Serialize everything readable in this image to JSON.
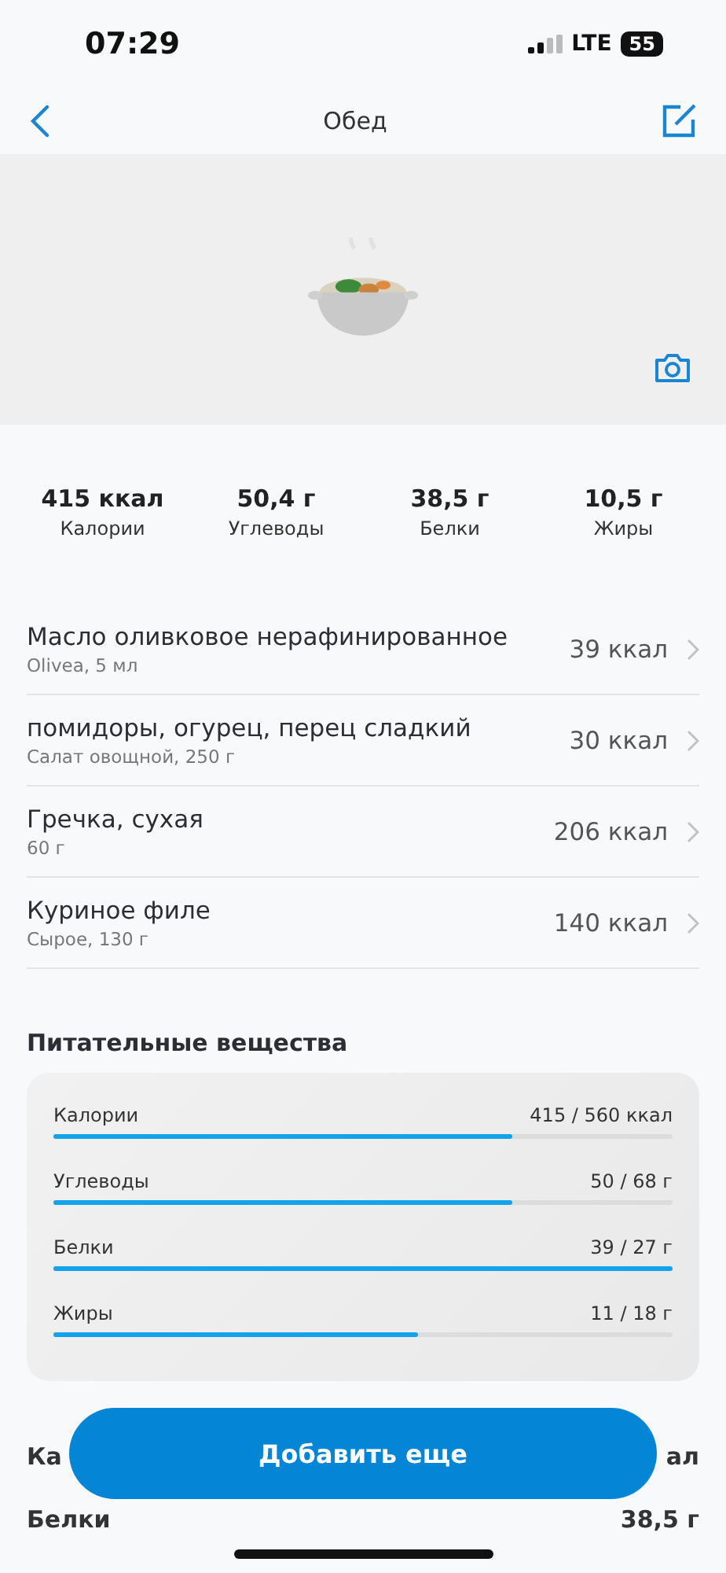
{
  "status_bar": {
    "time": "07:29",
    "network": "LTE",
    "battery": "55"
  },
  "nav": {
    "title": "Обед"
  },
  "totals": [
    {
      "value": "415 ккал",
      "label": "Калории"
    },
    {
      "value": "50,4 г",
      "label": "Углеводы"
    },
    {
      "value": "38,5 г",
      "label": "Белки"
    },
    {
      "value": "10,5 г",
      "label": "Жиры"
    }
  ],
  "foods": [
    {
      "name": "Масло оливковое нерафинированное",
      "detail": "Olivea, 5 мл",
      "calories": "39 ккал"
    },
    {
      "name": "помидоры, огурец, перец сладкий",
      "detail": "Салат  овощной, 250 г",
      "calories": "30 ккал"
    },
    {
      "name": "Гречка, сухая",
      "detail": "60 г",
      "calories": "206 ккал"
    },
    {
      "name": "Куриное филе",
      "detail": "Сырое, 130 г",
      "calories": "140 ккал"
    }
  ],
  "nutrients": {
    "title": "Питательные вещества",
    "items": [
      {
        "name": "Калории",
        "reading": "415 / 560 ккал",
        "level": 0.74
      },
      {
        "name": "Углеводы",
        "reading": "50 / 68 г",
        "level": 0.74
      },
      {
        "name": "Белки",
        "reading": "39 / 27 г",
        "level": 1
      },
      {
        "name": "Жиры",
        "reading": "11 / 18 г",
        "level": 0.59
      }
    ]
  },
  "summary_rows": [
    {
      "label": "Ка",
      "value": "ал"
    },
    {
      "label": "Белки",
      "value": "38,5 г"
    }
  ],
  "add_button": "Добавить еще"
}
